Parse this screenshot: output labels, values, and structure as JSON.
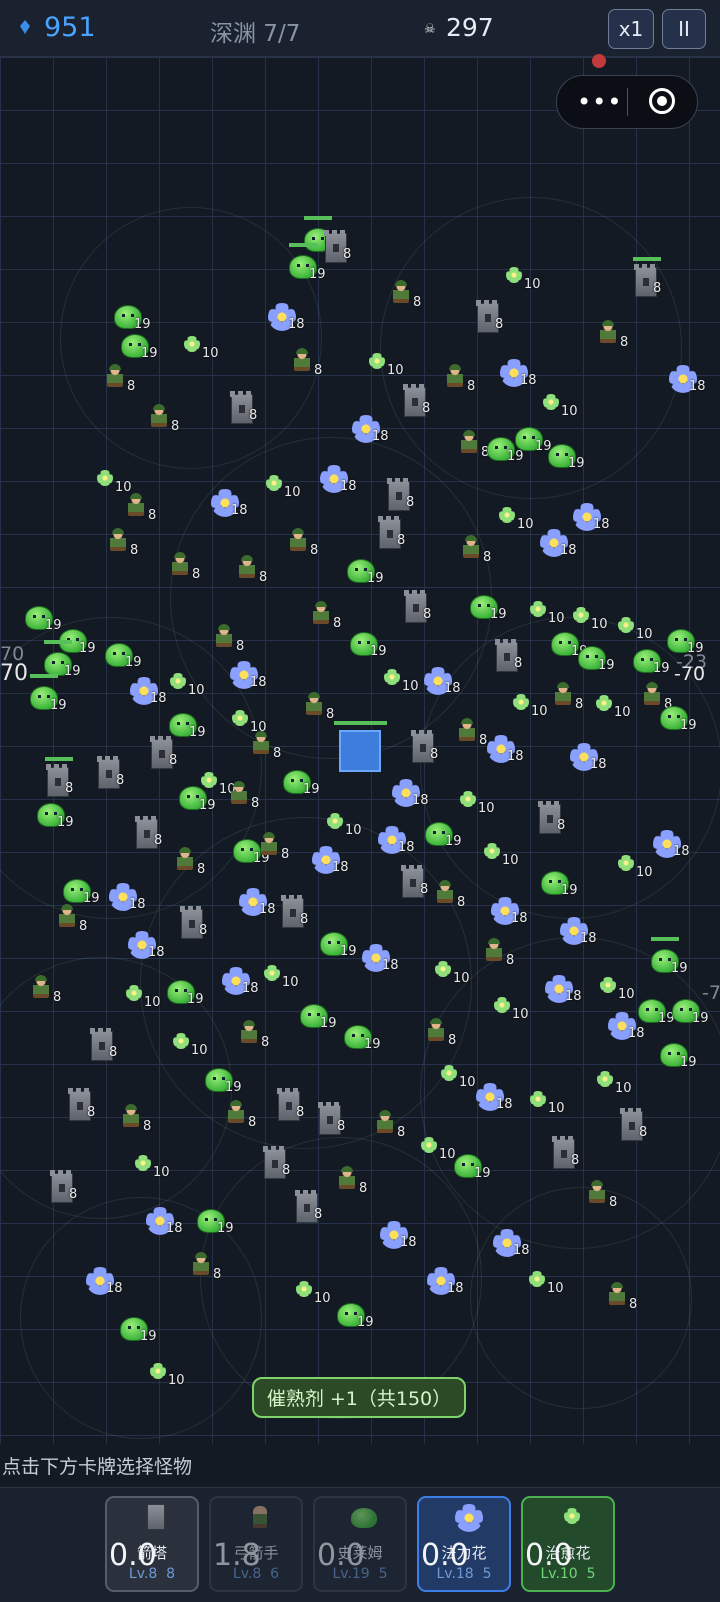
{
  "header": {
    "gold_icon": "blue-crystal-icon",
    "gold": "951",
    "level": "深渊 7/7",
    "kills_icon": "skull-icon",
    "kills": "297",
    "speed_label": "x1",
    "pause_label": "II"
  },
  "capsule": {
    "menu_label": "•••",
    "close_icon": "target-icon"
  },
  "field": {
    "edge_left_1": "70",
    "edge_left_2": "70",
    "edge_right_1": "-23",
    "edge_right_2": "-70",
    "edge_right_3": "-7"
  },
  "banner": "催熟剂 +1（共150）",
  "hint": "点击下方卡牌选择怪物",
  "cards": [
    {
      "name": "箭塔",
      "level": "Lv.8",
      "count": "8",
      "cooldown": "0.0",
      "icon": "tower-icon"
    },
    {
      "name": "弓箭手",
      "level": "Lv.8",
      "count": "6",
      "cooldown": "1.8",
      "icon": "archer-icon"
    },
    {
      "name": "史莱姆",
      "level": "Lv.19",
      "count": "5",
      "cooldown": "0.0",
      "icon": "slime-icon"
    },
    {
      "name": "法力花",
      "level": "Lv.18",
      "count": "5",
      "cooldown": "0.0",
      "icon": "mana-flower-icon"
    },
    {
      "name": "治愈花",
      "level": "Lv.10",
      "count": "5",
      "cooldown": "0.0",
      "icon": "healing-flower-icon"
    }
  ],
  "unit_levels": {
    "tower": "8",
    "archer": "8",
    "slime": "19",
    "mana_flower": "18",
    "heal_flower": "10"
  }
}
